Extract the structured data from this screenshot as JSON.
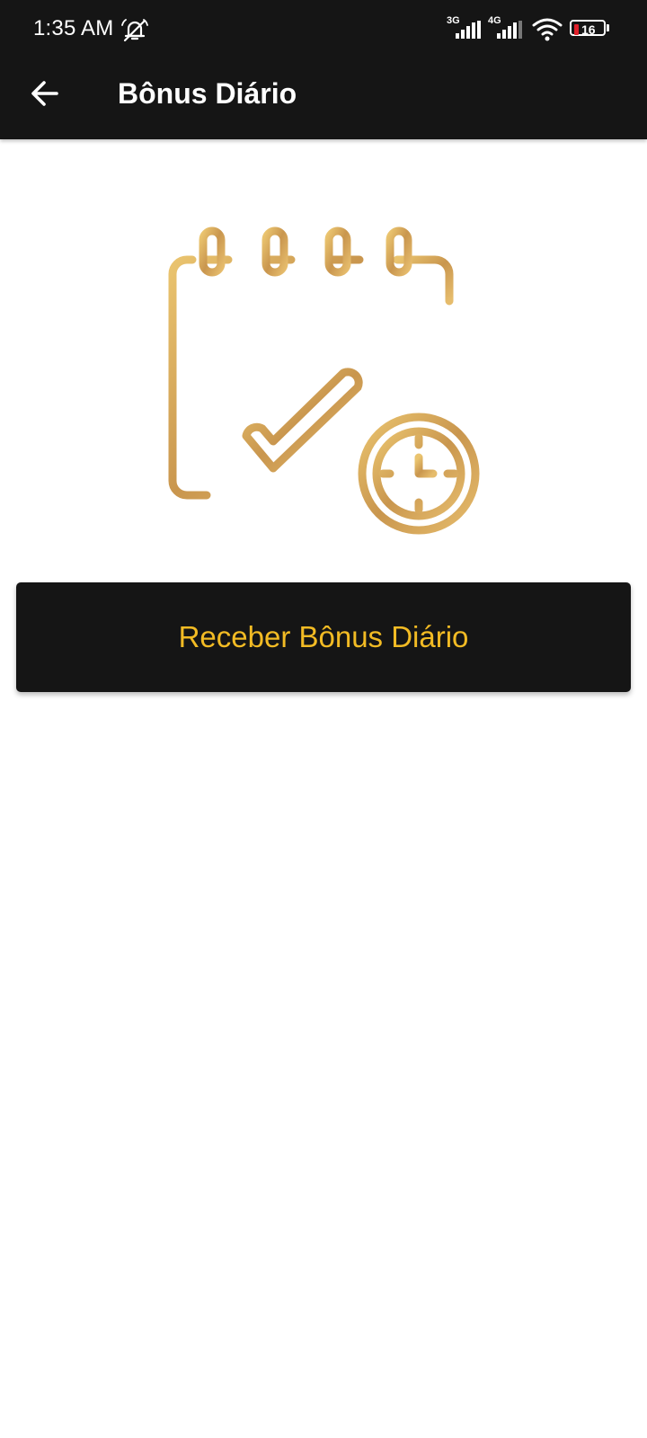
{
  "status_bar": {
    "time": "1:35 AM",
    "network_1": "3G",
    "network_2": "4G",
    "battery_level": "16",
    "icons": [
      "mute-notification-icon",
      "signal-icon",
      "signal-icon",
      "wifi-icon",
      "battery-icon"
    ]
  },
  "header": {
    "title": "Bônus Diário",
    "back_icon": "arrow-left-icon"
  },
  "hero": {
    "icon": "calendar-check-clock-icon"
  },
  "actions": {
    "claim_label": "Receber Bônus Diário"
  },
  "colors": {
    "bar_background": "#151515",
    "accent_gold": "#f2bb24",
    "icon_gold": "#d4a55c",
    "battery_low": "#e0202a",
    "page_background": "#ffffff"
  }
}
